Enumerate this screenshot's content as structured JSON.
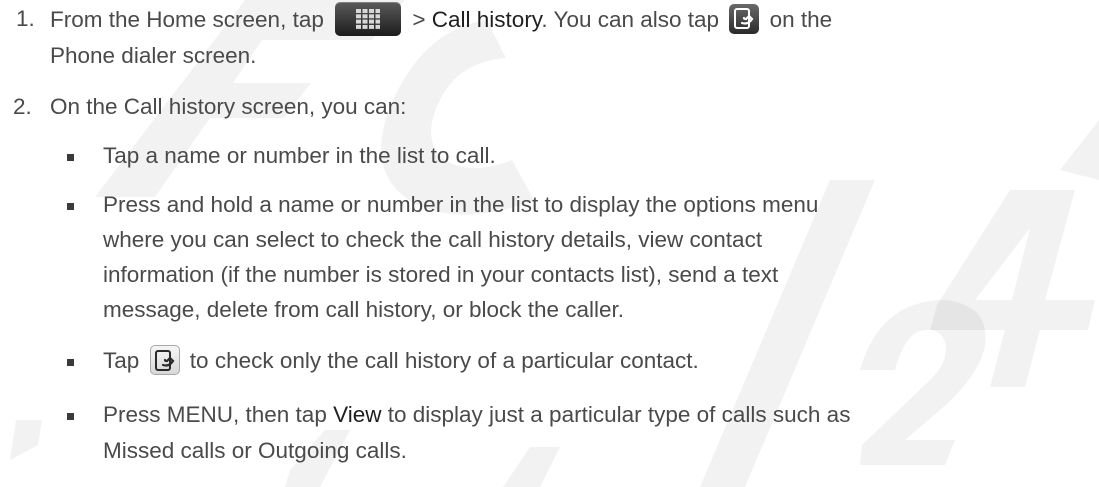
{
  "watermark": {
    "color": "#1e1e1e"
  },
  "step1": {
    "number": "1.",
    "line1_pre": "From the Home screen, tap",
    "line1_sep": " > ",
    "line1_bold": "Call history",
    "line1_mid": ". You can also tap",
    "line1_post": " on the",
    "line2": "Phone dialer screen.",
    "apps_icon": "apps-grid-icon",
    "history_icon": "call-history-icon"
  },
  "step2": {
    "number": "2.",
    "intro": "On the Call history screen, you can:",
    "bullets": [
      {
        "lines": [
          "Tap a name or number in the list to call."
        ]
      },
      {
        "lines": [
          "Press and hold a name or number in the list to display the options menu",
          "where you can select to check the call history details, view contact",
          "information (if the number is stored in your contacts list), send a text",
          "message, delete from call history, or block the caller."
        ]
      },
      {
        "pre": "Tap",
        "post": " to check only the call history of a particular contact.",
        "icon": "call-history-icon"
      },
      {
        "pre": "Press MENU, then tap ",
        "bold": "View",
        "post": " to display just a particular type of calls such as",
        "line2": "Missed calls or Outgoing calls."
      }
    ]
  }
}
